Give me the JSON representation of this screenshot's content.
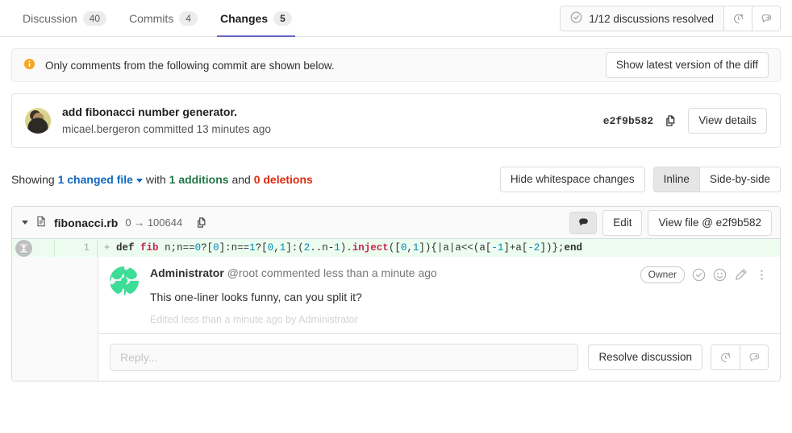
{
  "tabs": [
    {
      "label": "Discussion",
      "count": "40",
      "active": false,
      "name": "tab-discussion"
    },
    {
      "label": "Commits",
      "count": "4",
      "active": false,
      "name": "tab-commits"
    },
    {
      "label": "Changes",
      "count": "5",
      "active": true,
      "name": "tab-changes"
    }
  ],
  "header_right": {
    "resolved_text": "1/12 discussions resolved",
    "resolved_icon": "check-circle-icon",
    "jump_icon": "next-unresolved-discussion-icon",
    "reply_icon": "start-review-reply-icon"
  },
  "alert": {
    "icon": "info-icon",
    "icon_color": "#f5a623",
    "text": "Only comments from the following commit are shown below.",
    "action_label": "Show latest version of the diff"
  },
  "commit": {
    "title": "add fibonacci number generator.",
    "author_line": "micael.bergeron committed 13 minutes ago",
    "sha": "e2f9b582",
    "copy_icon": "copy-icon",
    "details_label": "View details",
    "avatar": "user-avatar"
  },
  "showing": {
    "prefix": "Showing",
    "files_label": "1 changed file",
    "with": "with",
    "additions": "1 additions",
    "and": "and",
    "deletions": "0 deletions",
    "whitespace_label": "Hide whitespace changes",
    "view_modes": [
      {
        "label": "Inline",
        "active": true
      },
      {
        "label": "Side-by-side",
        "active": false
      }
    ]
  },
  "diff": {
    "file_icon": "file-icon",
    "collapse_icon": "chevron-down-icon",
    "file_name": "fibonacci.rb",
    "file_mode": "0 → 100644",
    "copy_path_icon": "copy-icon",
    "comment_toggle_icon": "comment-filled-icon",
    "edit_label": "Edit",
    "view_file_label": "View file @ e2f9b582",
    "expand_icon": "expand-lines-icon",
    "line": {
      "old_num": "",
      "new_num": "1",
      "marker": "+",
      "tokens": [
        {
          "t": "def ",
          "c": "kw"
        },
        {
          "t": "fib",
          "c": "fn"
        },
        {
          "t": " n;n==",
          "c": ""
        },
        {
          "t": "0",
          "c": "num"
        },
        {
          "t": "?[",
          "c": ""
        },
        {
          "t": "0",
          "c": "num"
        },
        {
          "t": "]:n==",
          "c": ""
        },
        {
          "t": "1",
          "c": "num"
        },
        {
          "t": "?[",
          "c": ""
        },
        {
          "t": "0",
          "c": "num"
        },
        {
          "t": ",",
          "c": ""
        },
        {
          "t": "1",
          "c": "num"
        },
        {
          "t": "]:(",
          "c": ""
        },
        {
          "t": "2",
          "c": "num"
        },
        {
          "t": "..n-",
          "c": ""
        },
        {
          "t": "1",
          "c": "num"
        },
        {
          "t": ").",
          "c": ""
        },
        {
          "t": "inject",
          "c": "fn"
        },
        {
          "t": "([",
          "c": ""
        },
        {
          "t": "0",
          "c": "num"
        },
        {
          "t": ",",
          "c": ""
        },
        {
          "t": "1",
          "c": "num"
        },
        {
          "t": "]){|a|a<<(a[",
          "c": ""
        },
        {
          "t": "-1",
          "c": "num"
        },
        {
          "t": "]+a[",
          "c": ""
        },
        {
          "t": "-2",
          "c": "num"
        },
        {
          "t": "])};",
          "c": ""
        },
        {
          "t": "end",
          "c": "kw"
        }
      ],
      "plain": "def fib n;n==0?[0]:n==1?[0,1]:(2..n-1).inject([0,1]){|a|a<<(a[-1]+a[-2])};end"
    }
  },
  "note": {
    "avatar": "identicon-avatar",
    "author": "Administrator",
    "handle_and_time": "@root commented less than a minute ago",
    "badge": "Owner",
    "resolve_icon": "check-circle-icon",
    "emoji_icon": "smiley-icon",
    "edit_icon": "pencil-icon",
    "more_icon": "ellipsis-vertical-icon",
    "body": "This one-liner looks funny, can you split it?",
    "edited": "Edited less than a minute ago by Administrator"
  },
  "reply": {
    "placeholder": "Reply...",
    "value": "",
    "resolve_label": "Resolve discussion",
    "jump_icon": "next-unresolved-discussion-icon",
    "reply_icon": "start-review-reply-icon"
  }
}
